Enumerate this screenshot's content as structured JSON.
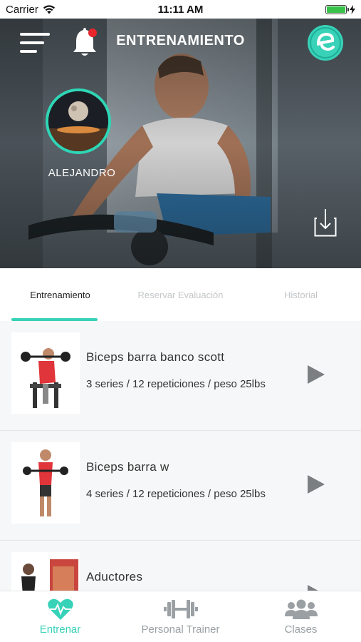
{
  "status_bar": {
    "carrier": "Carrier",
    "time": "11:11 AM",
    "battery_level": 1.0
  },
  "header": {
    "title": "ENTRENAMIENTO",
    "menu_icon": "hamburger-menu-icon",
    "bell_icon": "bell-icon",
    "logo_icon": "brand-logo-icon",
    "notification_dot": true,
    "download_icon": "download-icon"
  },
  "profile": {
    "name": "ALEJANDRO"
  },
  "tabs": [
    {
      "label": "Entrenamiento",
      "active": true
    },
    {
      "label": "Reservar Evaluación",
      "active": false
    },
    {
      "label": "Historial",
      "active": false
    }
  ],
  "exercises": [
    {
      "title": "Biceps barra banco scott",
      "detail": "3 series / 12 repeticiones / peso 25lbs"
    },
    {
      "title": "Biceps barra w",
      "detail": "4 series / 12 repeticiones / peso 25lbs"
    },
    {
      "title": "Aductores",
      "detail": ""
    }
  ],
  "bottom_nav": [
    {
      "label": "Entrenar",
      "icon": "heart-pulse-icon",
      "active": true
    },
    {
      "label": "Personal Trainer",
      "icon": "dumbbell-icon",
      "active": false
    },
    {
      "label": "Clases",
      "icon": "group-icon",
      "active": false
    }
  ],
  "colors": {
    "accent": "#37d2b8",
    "notification": "#e8262b",
    "text": "#333333"
  }
}
